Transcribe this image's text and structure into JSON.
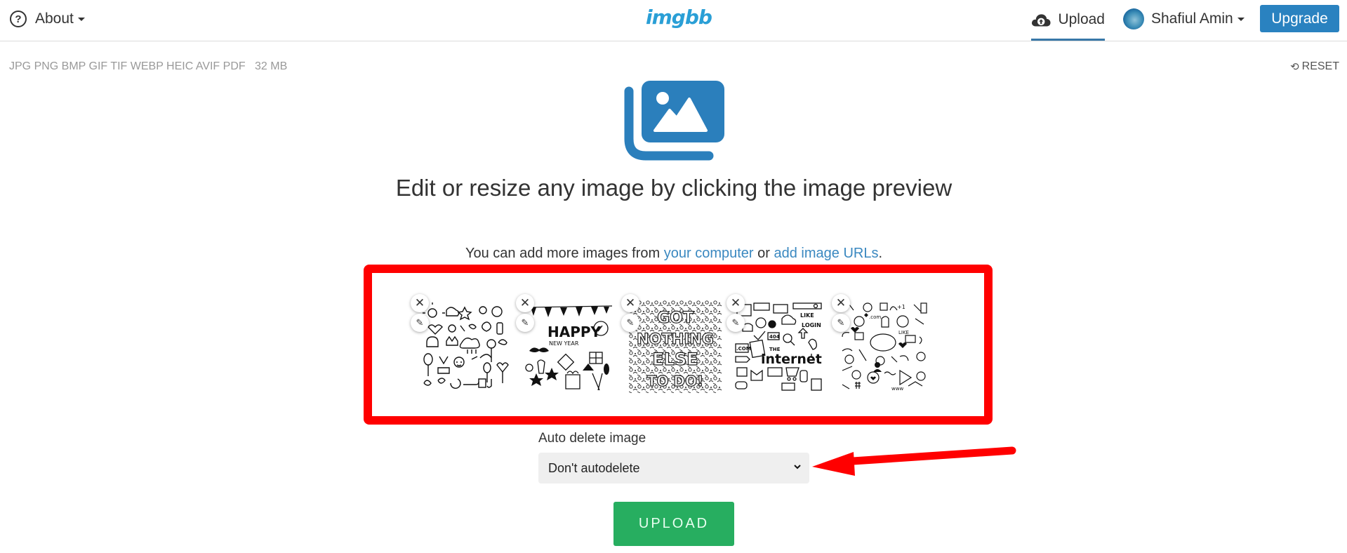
{
  "header": {
    "about_label": "About",
    "logo_text": "imgbb",
    "upload_tab_label": "Upload",
    "user_name": "Shafiul Amin",
    "upgrade_label": "Upgrade"
  },
  "toolbar": {
    "formats_text": "JPG PNG BMP GIF TIF WEBP HEIC AVIF PDF",
    "max_size": "32 MB",
    "reset_label": "RESET"
  },
  "main": {
    "title": "Edit or resize any image by clicking the image preview",
    "subtitle_prefix": "You can add more images from ",
    "link_computer": "your computer",
    "subtitle_mid": " or ",
    "link_urls": "add image URLs",
    "subtitle_suffix": "."
  },
  "thumbnails": [
    {
      "description": "doodle pattern"
    },
    {
      "description": "Happy New Year doodle"
    },
    {
      "description": "Got nothing else to do doodle"
    },
    {
      "description": "The internet doodle"
    },
    {
      "description": "Social media doodle"
    }
  ],
  "thumb_texts": {
    "t2": "HAPPY",
    "t2b": "NEW YEAR",
    "t3a": "GOT",
    "t3b": "NOTHING",
    "t3c": "ELSE",
    "t3d": "TO DO!",
    "t4a": "THE",
    "t4b": "internet",
    "t4c": ".COM",
    "t4d": "LOGIN",
    "t4e": "404",
    "t4f": "LIKE",
    "t5a": ".com",
    "t5b": "+1",
    "t5c": "LIKE",
    "t5d": "www"
  },
  "form": {
    "auto_delete_label": "Auto delete image",
    "auto_delete_value": "Don't autodelete",
    "upload_button": "UPLOAD"
  },
  "colors": {
    "brand_blue": "#2a82c0",
    "upload_green": "#27ae60",
    "annotation_red": "#ff0000"
  }
}
